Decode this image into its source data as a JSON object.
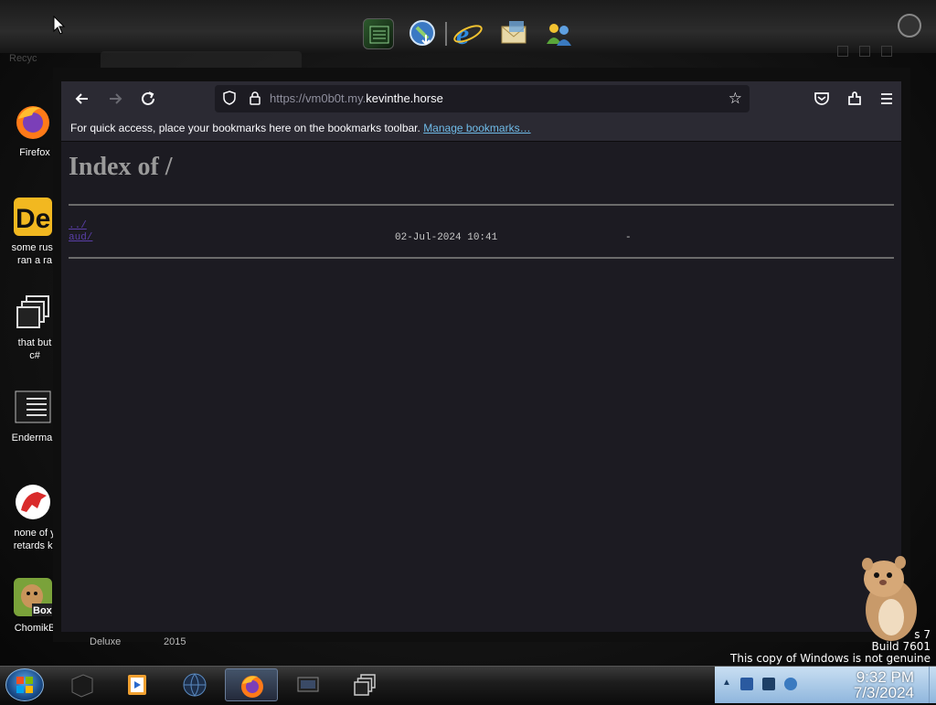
{
  "dock": {
    "icons": [
      "matrix-app-icon",
      "globe-download-icon",
      "internet-explorer-icon",
      "mail-envelope-icon",
      "messenger-people-icon"
    ],
    "ghost_label": "Recyc"
  },
  "desktop_icons": [
    {
      "label": "Firefox",
      "icon": "firefox-icon"
    },
    {
      "label": "some russ\nran a ra",
      "icon": "de-app-icon"
    },
    {
      "label": "that but\nc#",
      "icon": "windows-stack-icon"
    },
    {
      "label": "Enderman",
      "icon": "terminal-list-icon"
    },
    {
      "label": "none of y\nretards kr",
      "icon": "red-dinosaur-icon"
    },
    {
      "label": "ChomikB",
      "icon": "chomik-box-icon"
    }
  ],
  "browser": {
    "url_prefix": "https://vm0b0t.my.",
    "url_domain": "kevinthe.horse",
    "bookmarks_message": "For quick access, place your bookmarks here on the bookmarks toolbar. ",
    "manage_bookmarks": "Manage bookmarks…",
    "page": {
      "heading": "Index of /",
      "parent_link": "../",
      "rows": [
        {
          "name": "aud/",
          "date": "02-Jul-2024 10:41",
          "size": "-"
        }
      ]
    }
  },
  "desktop_text": {
    "ghost_left": "Deluxe",
    "ghost_right": "2015",
    "watermark_line1": "s 7",
    "watermark_line2": "Build 7601",
    "watermark_line3": "This copy of Windows is not genuine"
  },
  "taskbar": {
    "items": [
      "black-box-icon",
      "media-player-icon",
      "globe-dark-icon",
      "firefox-icon",
      "monitor-icon",
      "windows-stack-icon"
    ],
    "active_index": 3
  },
  "clock": {
    "time": "9:32 PM",
    "date": "7/3/2024"
  },
  "colors": {
    "page_bg": "#1c1b22",
    "toolbar_bg": "#2b2a33",
    "link": "#6fbbe8",
    "visited_link": "#5a3fa8"
  }
}
